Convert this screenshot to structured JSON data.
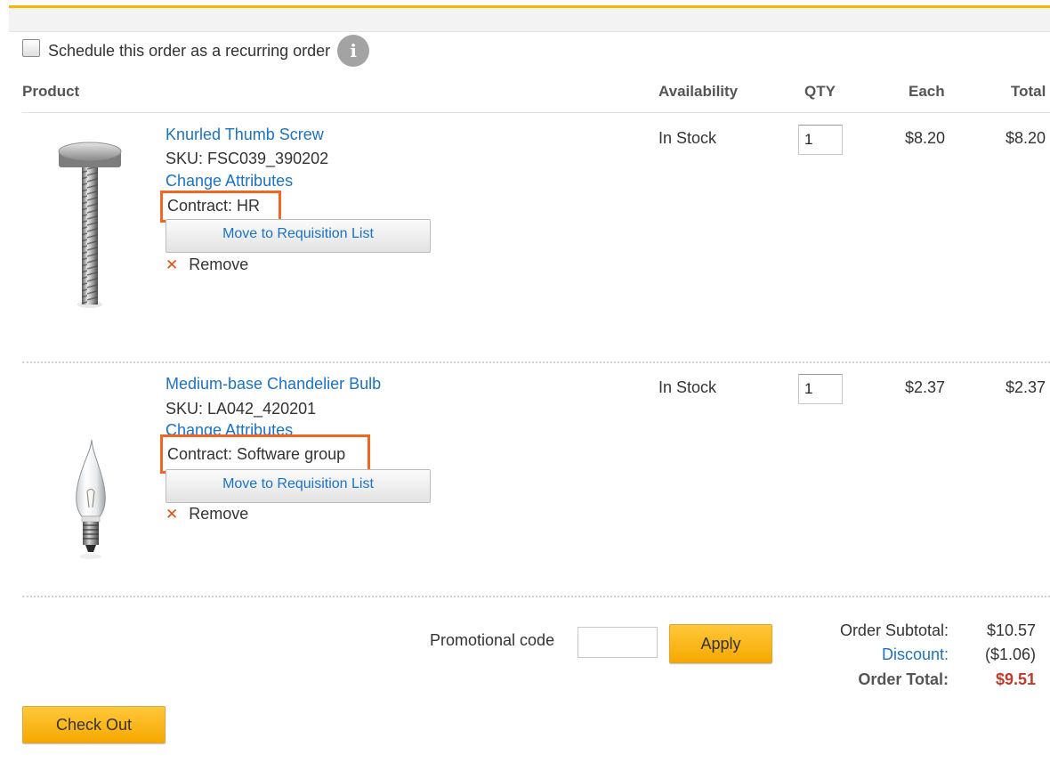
{
  "recurring": {
    "label": "Schedule this order as a recurring order",
    "info_glyph": "i",
    "checked": false
  },
  "table": {
    "headers": {
      "product": "Product",
      "availability": "Availability",
      "qty": "QTY",
      "each": "Each",
      "total": "Total"
    }
  },
  "items": [
    {
      "name": "Knurled Thumb Screw",
      "sku": "SKU: FSC039_390202",
      "change_attributes": "Change Attributes",
      "contract": "Contract: HR",
      "move_button": "Move to Requisition List",
      "remove": "Remove",
      "availability": "In Stock",
      "qty": "1",
      "each": "$8.20",
      "total": "$8.20",
      "image_icon": "thumb-screw-image"
    },
    {
      "name": "Medium-base Chandelier Bulb",
      "sku": "SKU: LA042_420201",
      "change_attributes": "Change Attributes",
      "contract": "Contract: Software group",
      "move_button": "Move to Requisition List",
      "remove": "Remove",
      "availability": "In Stock",
      "qty": "1",
      "each": "$2.37",
      "total": "$2.37",
      "image_icon": "chandelier-bulb-image"
    }
  ],
  "promo": {
    "label": "Promotional code",
    "value": "",
    "apply_button": "Apply"
  },
  "summary": {
    "subtotal_label": "Order Subtotal:",
    "subtotal_value": "$10.57",
    "discount_label": "Discount:",
    "discount_value": "($1.06)",
    "total_label": "Order Total:",
    "total_value": "$9.51"
  },
  "checkout_button": "Check Out",
  "colors": {
    "accent_yellow": "#f6a800",
    "link_blue": "#1a73c6",
    "highlight_orange": "#f26522",
    "total_red": "#c0392b",
    "remove_x": "#e84e0f"
  }
}
